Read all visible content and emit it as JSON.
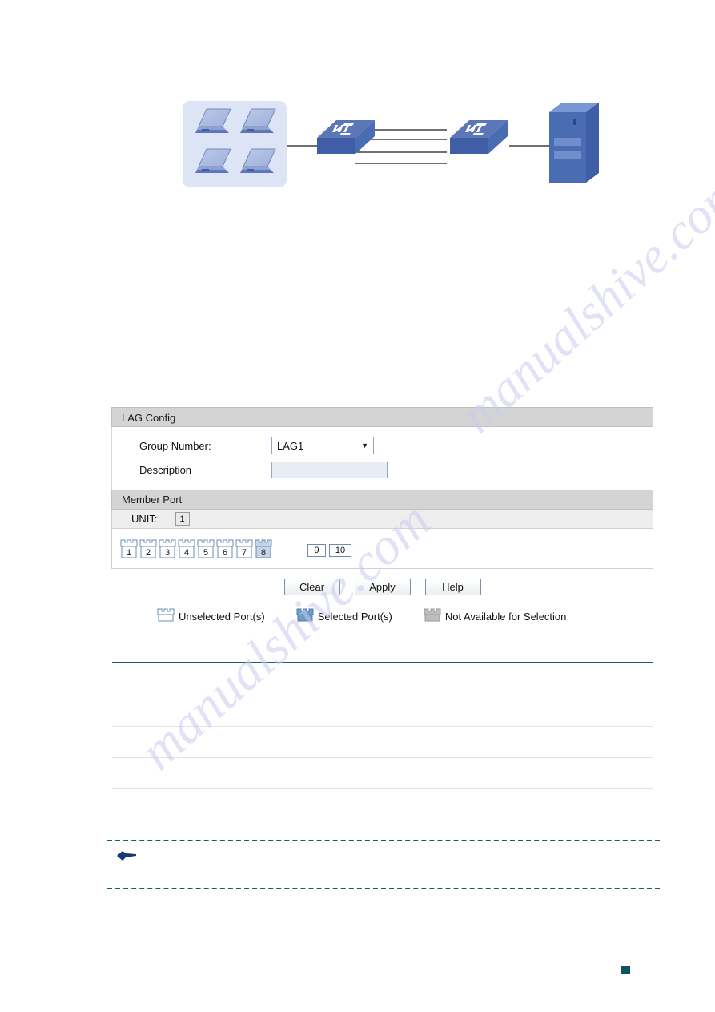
{
  "page": {
    "marker_color": "#0c5560",
    "divider_color": "#12616b"
  },
  "watermark": {
    "line1": "manualshive.com",
    "line2": "manualshive.com"
  },
  "diagram": {
    "name": "lag-topology-diagram",
    "client_group_label": "",
    "nodes": [
      {
        "name": "client-laptops-group",
        "type": "laptop-cluster",
        "count": 4
      },
      {
        "name": "switch-left",
        "type": "switch"
      },
      {
        "name": "switch-right",
        "type": "switch"
      },
      {
        "name": "server",
        "type": "server"
      }
    ],
    "aggregated_links": 4,
    "colors": {
      "group_bg": "#dde4f5",
      "device_blue": "#4a6cb3",
      "device_blue_dark": "#3a5699",
      "device_blue_light": "#7b96d4"
    }
  },
  "lag_config": {
    "panel_title": "LAG Config",
    "group_number_label": "Group Number:",
    "group_number_value": "LAG1",
    "group_number_options": [
      "LAG1"
    ],
    "description_label": "Description",
    "description_value": "",
    "description_placeholder": ""
  },
  "member_port": {
    "panel_title": "Member Port",
    "unit_label": "UNIT:",
    "unit_value": "1",
    "ports": [
      {
        "number": "1",
        "type": "rj45",
        "state": "unselected"
      },
      {
        "number": "2",
        "type": "rj45",
        "state": "unselected"
      },
      {
        "number": "3",
        "type": "rj45",
        "state": "unselected"
      },
      {
        "number": "4",
        "type": "rj45",
        "state": "unselected"
      },
      {
        "number": "5",
        "type": "rj45",
        "state": "unselected"
      },
      {
        "number": "6",
        "type": "rj45",
        "state": "unselected"
      },
      {
        "number": "7",
        "type": "rj45",
        "state": "unselected"
      },
      {
        "number": "8",
        "type": "rj45",
        "state": "selected"
      },
      {
        "number": "9",
        "type": "sfp",
        "state": "unselected"
      },
      {
        "number": "10",
        "type": "sfp",
        "state": "unselected"
      }
    ]
  },
  "buttons": {
    "clear": "Clear",
    "apply": "Apply",
    "help": "Help"
  },
  "legend": {
    "items": [
      {
        "label": "Unselected Port(s)",
        "state": "unselected",
        "color": "#ffffff"
      },
      {
        "label": "Selected Port(s)",
        "state": "selected",
        "color": "#6d9dc5"
      },
      {
        "label": "Not Available for Selection",
        "state": "unavailable",
        "color": "#bdbdbd"
      }
    ]
  },
  "note": {
    "icon": "pointing-hand-icon",
    "text": ""
  }
}
